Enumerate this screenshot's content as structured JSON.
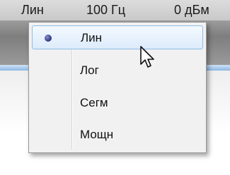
{
  "toolbar": {
    "scale": "Лин",
    "frequency": "100 Гц",
    "level": "0 дБм"
  },
  "menu": {
    "items": [
      {
        "label": "Лин",
        "selected": true
      },
      {
        "label": "Лог",
        "selected": false
      },
      {
        "label": "Сегм",
        "selected": false
      },
      {
        "label": "Мощн",
        "selected": false
      }
    ]
  },
  "colors": {
    "highlight_border": "#8fbce6",
    "radio_dot": "#2a3280",
    "menu_bg": "#f1f1f1"
  },
  "icons": {
    "radio": "radio-dot-icon",
    "cursor": "arrow-cursor-icon"
  }
}
